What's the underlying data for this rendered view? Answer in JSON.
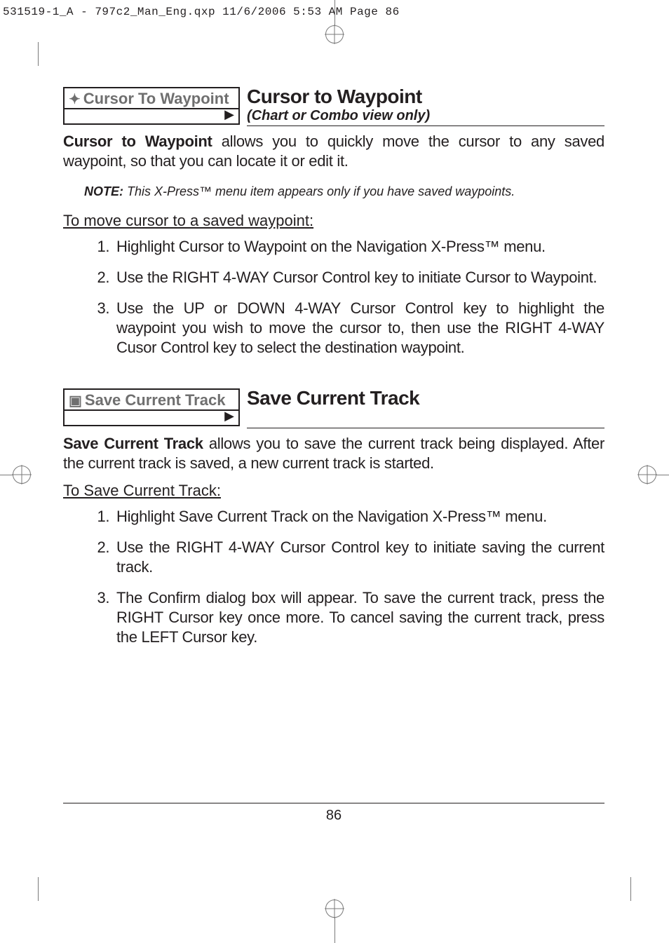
{
  "header": {
    "slug_line": "531519-1_A - 797c2_Man_Eng.qxp  11/6/2006  5:53 AM  Page 86"
  },
  "section1": {
    "ui_icon": "✦",
    "ui_label": "Cursor To Waypoint",
    "ui_arrow": "▶",
    "title": "Cursor to Waypoint",
    "subtitle": "(Chart or Combo view only)",
    "intro_html": "<strong>Cursor to Waypoint</strong> allows you to quickly move the cursor to any saved waypoint, so that you can locate it or edit it.",
    "note_html": "<strong>NOTE:</strong> This X-Press™ menu item appears only if you have saved waypoints.",
    "howto_head": "To move cursor to a saved waypoint:",
    "steps": [
      "Highlight Cursor to Waypoint on the Navigation X-Press™ menu.",
      "Use the RIGHT 4-WAY Cursor Control key to initiate Cursor to Waypoint.",
      "Use the UP or DOWN 4-WAY Cursor Control key to highlight the waypoint you wish to move the cursor to, then use the RIGHT 4-WAY Cusor Control key to select the destination waypoint."
    ]
  },
  "section2": {
    "ui_icon": "▣",
    "ui_label": "Save Current Track",
    "ui_arrow": "▶",
    "title": "Save Current Track",
    "intro_html": "<strong>Save Current Track</strong> allows you to save the current track being displayed. After the current track is saved, a new current track is started.",
    "howto_head": "To Save Current Track:",
    "steps": [
      "Highlight Save Current Track on the Navigation X-Press™ menu.",
      "Use the RIGHT 4-WAY Cursor Control key to initiate saving the current track.",
      "The Confirm dialog box will appear. To save the current track, press the RIGHT Cursor key once more. To cancel saving the current track, press the LEFT Cursor key."
    ]
  },
  "footer": {
    "page_number": "86"
  }
}
